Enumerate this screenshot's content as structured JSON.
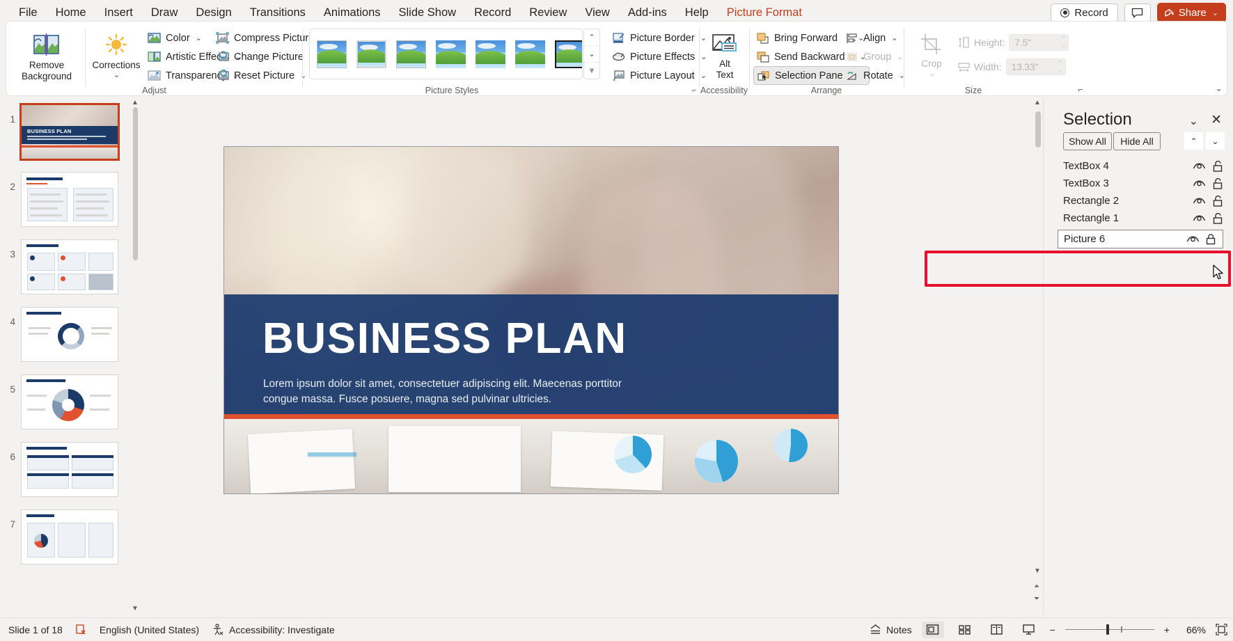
{
  "menu": {
    "items": [
      {
        "label": "File",
        "active": false
      },
      {
        "label": "Home",
        "active": false
      },
      {
        "label": "Insert",
        "active": false
      },
      {
        "label": "Draw",
        "active": false
      },
      {
        "label": "Design",
        "active": false
      },
      {
        "label": "Transitions",
        "active": false
      },
      {
        "label": "Animations",
        "active": false
      },
      {
        "label": "Slide Show",
        "active": false
      },
      {
        "label": "Record",
        "active": false
      },
      {
        "label": "Review",
        "active": false
      },
      {
        "label": "View",
        "active": false
      },
      {
        "label": "Add-ins",
        "active": false
      },
      {
        "label": "Help",
        "active": false
      },
      {
        "label": "Picture Format",
        "active": true
      }
    ],
    "record_button": "Record",
    "comment_button": "comment-icon",
    "share_button": "Share"
  },
  "ribbon": {
    "groups": {
      "adjust": {
        "label": "Adjust",
        "remove_background": "Remove\nBackground",
        "remove_background_line1": "Remove",
        "remove_background_line2": "Background",
        "corrections": "Corrections",
        "color": "Color",
        "artistic_effects": "Artistic Effects",
        "transparency": "Transparency",
        "compress_pictures": "Compress Pictures",
        "change_picture": "Change Picture",
        "reset_picture": "Reset Picture"
      },
      "picture_styles": {
        "label": "Picture Styles",
        "thumbs": [
          {
            "name": "simple-frame-white",
            "selected": false
          },
          {
            "name": "beveled-matte-white",
            "selected": false
          },
          {
            "name": "metal-frame",
            "selected": false
          },
          {
            "name": "drop-shadow-rectangle",
            "selected": false
          },
          {
            "name": "reflected-rounded-rectangle",
            "selected": false
          },
          {
            "name": "soft-edge-rectangle",
            "selected": false
          },
          {
            "name": "double-frame-black",
            "selected": true
          }
        ],
        "picture_border": "Picture Border",
        "picture_effects": "Picture Effects",
        "picture_layout": "Picture Layout"
      },
      "accessibility": {
        "label": "Accessibility",
        "alt_text_line1": "Alt",
        "alt_text_line2": "Text"
      },
      "arrange": {
        "label": "Arrange",
        "bring_forward": "Bring Forward",
        "send_backward": "Send Backward",
        "selection_pane": "Selection Pane",
        "align": "Align",
        "group": "Group",
        "rotate": "Rotate"
      },
      "size": {
        "label": "Size",
        "crop": "Crop",
        "height_label": "Height:",
        "height_value": "7.5\"",
        "width_label": "Width:",
        "width_value": "13.33\""
      }
    }
  },
  "thumbnails": {
    "slides": [
      {
        "number": "1",
        "active": true
      },
      {
        "number": "2",
        "active": false
      },
      {
        "number": "3",
        "active": false
      },
      {
        "number": "4",
        "active": false
      },
      {
        "number": "5",
        "active": false
      },
      {
        "number": "6",
        "active": false
      },
      {
        "number": "7",
        "active": false
      }
    ]
  },
  "slide": {
    "title": "BUSINESS PLAN",
    "subtitle": "Lorem ipsum dolor sit amet, consectetuer adipiscing elit. Maecenas porttitor congue massa. Fusce posuere, magna sed pulvinar ultricies.",
    "band_color": "#1d3c6e",
    "accent_color": "#e0512f"
  },
  "selection_pane": {
    "title": "Selection",
    "show_all": "Show All",
    "hide_all": "Hide All",
    "items": [
      {
        "label": "TextBox 4",
        "visible": true,
        "locked": false,
        "editing": false
      },
      {
        "label": "TextBox 3",
        "visible": true,
        "locked": false,
        "editing": false
      },
      {
        "label": "Rectangle 2",
        "visible": true,
        "locked": false,
        "editing": false
      },
      {
        "label": "Rectangle 1",
        "visible": true,
        "locked": false,
        "editing": false
      },
      {
        "label": "Picture 6",
        "visible": true,
        "locked": true,
        "editing": true
      }
    ]
  },
  "status_bar": {
    "slide_count": "Slide 1 of 18",
    "language": "English (United States)",
    "accessibility": "Accessibility: Investigate",
    "notes": "Notes",
    "zoom": "66%"
  }
}
